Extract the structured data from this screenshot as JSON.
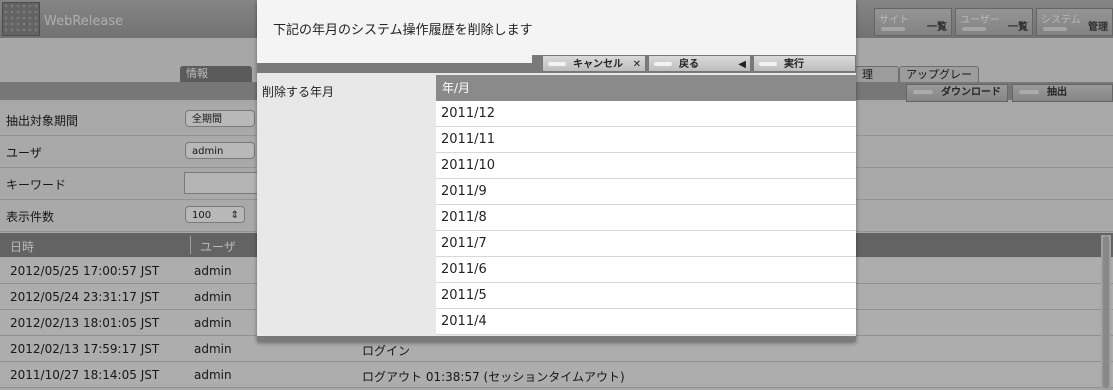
{
  "app": {
    "title": "WebRelease"
  },
  "header_buttons": [
    {
      "top": "サイト",
      "bottom": "一覧"
    },
    {
      "top": "ユーザー",
      "bottom": "一覧"
    },
    {
      "top": "システム",
      "bottom": "管理"
    }
  ],
  "tabs": {
    "info": "情報",
    "partial": "理",
    "upgrade": "アップグレード"
  },
  "strip_buttons": {
    "download": "ダウンロード",
    "extract": "抽出"
  },
  "form": {
    "period_label": "抽出対象期間",
    "period_value": "全期間",
    "user_label": "ユーザ",
    "user_value": "admin",
    "keyword_label": "キーワード",
    "count_label": "表示件数",
    "count_value": "100"
  },
  "list": {
    "col_datetime": "日時",
    "col_user": "ユーザ",
    "rows": [
      {
        "datetime": "2012/05/25 17:00:57 JST",
        "user": "admin",
        "action": ""
      },
      {
        "datetime": "2012/05/24 23:31:17 JST",
        "user": "admin",
        "action": ""
      },
      {
        "datetime": "2012/02/13 18:01:05 JST",
        "user": "admin",
        "action": ""
      },
      {
        "datetime": "2012/02/13 17:59:17 JST",
        "user": "admin",
        "action": "ログイン"
      },
      {
        "datetime": "2011/10/27 18:14:05 JST",
        "user": "admin",
        "action": "ログアウト 01:38:57 (セッションタイムアウト)"
      }
    ]
  },
  "dialog": {
    "message": "下記の年月のシステム操作履歴を削除します",
    "cancel": "キャンセル",
    "back": "戻る",
    "execute": "実行",
    "left_label": "削除する年月",
    "table_header": "年/月",
    "months": [
      "2011/12",
      "2011/11",
      "2011/10",
      "2011/9",
      "2011/8",
      "2011/7",
      "2011/6",
      "2011/5",
      "2011/4"
    ]
  }
}
